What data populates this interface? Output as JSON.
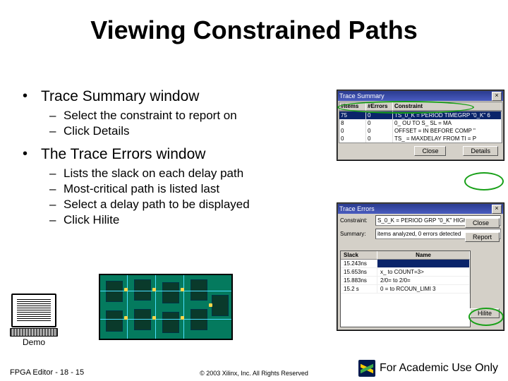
{
  "title": "Viewing Constrained Paths",
  "bullets": [
    {
      "heading": "Trace Summary window",
      "items": [
        "Select the constraint to report on",
        "Click Details"
      ]
    },
    {
      "heading": "The Trace Errors window",
      "items": [
        "Lists the slack on each delay path",
        "Most-critical path is listed last",
        "Select a delay path to be displayed",
        "Click Hilite"
      ]
    }
  ],
  "trace_summary": {
    "titlebar": "Trace Summary",
    "close": "×",
    "cols": [
      "#Items",
      "#Errors",
      "Constraint"
    ],
    "rows": [
      [
        "75",
        "0",
        "TS_0_K = PERIOD TIMEGRP \"0_K\" 6"
      ],
      [
        "8",
        "0",
        "0_   OU TO S_   SL = MA"
      ],
      [
        "0",
        "0",
        "OFFSET = IN BEFORE COMP \""
      ],
      [
        "0",
        "0",
        "TS_ = MAXDELAY FROM TI = P"
      ]
    ],
    "buttons": {
      "close_btn": "Close",
      "details_btn": "Details"
    }
  },
  "trace_errors": {
    "titlebar": "Trace Errors",
    "close": "×",
    "fields": {
      "constraint_label": "Constraint:",
      "constraint_value": "S_0_K = PERIOD   GRP \"0_K\"   HIGH",
      "summary_label": "Summary:",
      "summary_value": "items analyzed, 0 errors detected"
    },
    "buttons": {
      "close_btn": "Close",
      "report_btn": "Report",
      "hilite_btn": "Hilite"
    },
    "cols": [
      "Slack",
      "Name"
    ],
    "rows": [
      [
        "15.243ns",
        ""
      ],
      [
        "15.653ns",
        "x_   to    COUNT=3>"
      ],
      [
        "15.883ns",
        "2/0= to 2/0="
      ],
      [
        "15.2   s",
        "0   = to RCOUN_LIMI 3"
      ]
    ]
  },
  "demo_label": "Demo",
  "footer": {
    "left": "FPGA Editor  -  18 - 15",
    "center": "© 2003 Xilinx, Inc. All Rights Reserved",
    "right": "For Academic Use Only",
    "logo_alt": "XILINX"
  }
}
